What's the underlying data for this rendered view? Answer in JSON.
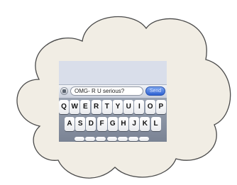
{
  "message": {
    "text": "OMG- R U serious?"
  },
  "send": {
    "label": "Send"
  },
  "icons": {
    "camera": "camera-icon"
  },
  "colors": {
    "cloud_fill": "#f1ede4",
    "cloud_stroke": "#4a4a4a",
    "send_button": "#3b6fdc",
    "keyboard_bg": "#8a93a3"
  },
  "keyboard": {
    "row1": [
      "Q",
      "W",
      "E",
      "R",
      "T",
      "Y",
      "U",
      "I",
      "O",
      "P"
    ],
    "row2": [
      "A",
      "S",
      "D",
      "F",
      "G",
      "H",
      "J",
      "K",
      "L"
    ]
  }
}
